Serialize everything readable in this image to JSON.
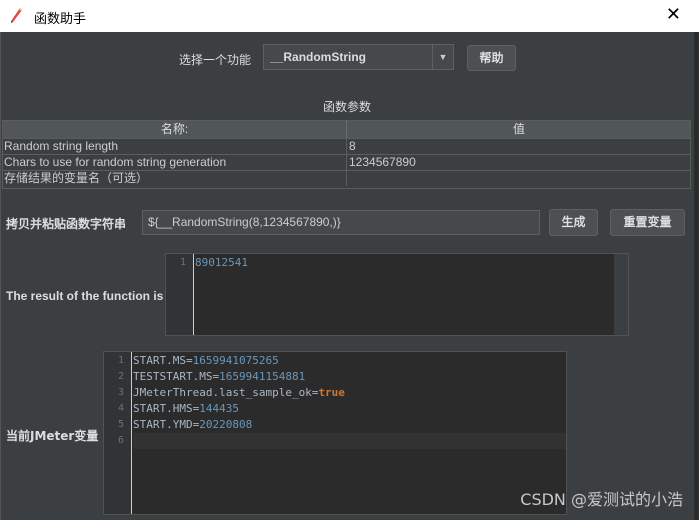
{
  "window": {
    "title": "函数助手",
    "close_glyph": "✕",
    "icon": "feather-pen-icon"
  },
  "function_select": {
    "label": "选择一个功能",
    "selected": "__RandomString",
    "arrow": "▼",
    "help_label": "帮助"
  },
  "params": {
    "section_title": "函数参数",
    "headers": [
      "名称:",
      "值"
    ],
    "rows": [
      {
        "name": "Random string length",
        "value": "8"
      },
      {
        "name": "Chars to use for random string generation",
        "value": "1234567890"
      },
      {
        "name": "存储结果的变量名（可选）",
        "value": ""
      }
    ]
  },
  "function_string": {
    "label": "拷贝并粘贴函数字符串",
    "value": "${__RandomString(8,1234567890,)}",
    "generate_label": "生成",
    "reset_label": "重置变量"
  },
  "result": {
    "label": "The result of the function is",
    "lines": [
      {
        "n": "1",
        "value": "89012541"
      }
    ]
  },
  "jmeter_vars": {
    "label": "当前JMeter变量",
    "lines": [
      {
        "n": "1",
        "key": "START.MS=",
        "value": "1659941075265"
      },
      {
        "n": "2",
        "key": "TESTSTART.MS=",
        "value": "1659941154881"
      },
      {
        "n": "3",
        "key": "JMeterThread.last_sample_ok=",
        "value": "true"
      },
      {
        "n": "4",
        "key": "START.HMS=",
        "value": "144435"
      },
      {
        "n": "5",
        "key": "START.YMD=",
        "value": "20220808"
      },
      {
        "n": "6",
        "key": "",
        "value": ""
      }
    ]
  },
  "watermark": "CSDN @爱测试的小浩",
  "colors": {
    "background": "#3c3f41",
    "editor_bg": "#2b2b2b",
    "number": "#6897bb",
    "keyword": "#cc7832",
    "text": "#a9b7c6"
  }
}
